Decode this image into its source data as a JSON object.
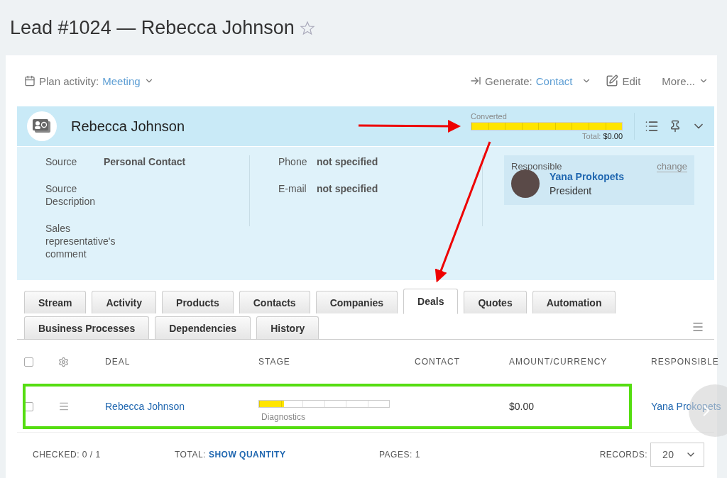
{
  "page": {
    "title": "Lead #1024 — Rebecca Johnson",
    "starred": false
  },
  "toolbar": {
    "plan_label": "Plan activity:",
    "plan_value": "Meeting",
    "generate_label": "Generate:",
    "generate_value": "Contact",
    "edit": "Edit",
    "more": "More..."
  },
  "header": {
    "name": "Rebecca Johnson",
    "stage_label": "Converted",
    "level": 1,
    "total_label": "Total:",
    "total_value": "$0.00"
  },
  "details": {
    "left": [
      {
        "label": "Source",
        "value": "Personal Contact"
      },
      {
        "label": "Source Description"
      },
      {
        "label": "Sales representative's comment"
      }
    ],
    "middle": [
      {
        "label": "Phone",
        "value": "not specified"
      },
      {
        "label": "E-mail",
        "value": "not specified"
      }
    ],
    "responsible": {
      "title": "Responsible",
      "change": "change",
      "name": "Yana Prokopets",
      "position": "President"
    }
  },
  "tabs": [
    [
      {
        "label": "Stream",
        "selected": false
      },
      {
        "label": "Activity",
        "selected": false
      },
      {
        "label": "Products",
        "selected": false
      },
      {
        "label": "Contacts",
        "selected": false
      },
      {
        "label": "Companies",
        "selected": false
      },
      {
        "label": "Deals",
        "selected": true
      },
      {
        "label": "Quotes",
        "selected": false
      },
      {
        "label": "Automation",
        "selected": false
      }
    ],
    [
      {
        "label": "Business Processes",
        "selected": false
      },
      {
        "label": "Dependencies",
        "selected": false
      },
      {
        "label": "History",
        "selected": false
      }
    ]
  ],
  "table": {
    "all_checked": false,
    "columns": [
      "DEAL",
      "STAGE",
      "CONTACT",
      "AMOUNT/CURRENCY",
      "RESPONSIBLE"
    ],
    "rows": [
      {
        "checked": false,
        "highlighted": true,
        "deal": "Rebecca Johnson",
        "level": 0.19,
        "stage": "Diagnostics",
        "amount": "$0.00",
        "responsible": "Yana Prokopets"
      }
    ]
  },
  "footer": {
    "checked_label": "CHECKED:",
    "checked_value": "0 / 1",
    "total_label": "TOTAL:",
    "total_link": "SHOW QUANTITY",
    "pages_label": "PAGES:",
    "pages_value": "1",
    "records_label": "RECORDS:",
    "records_value": "20"
  }
}
